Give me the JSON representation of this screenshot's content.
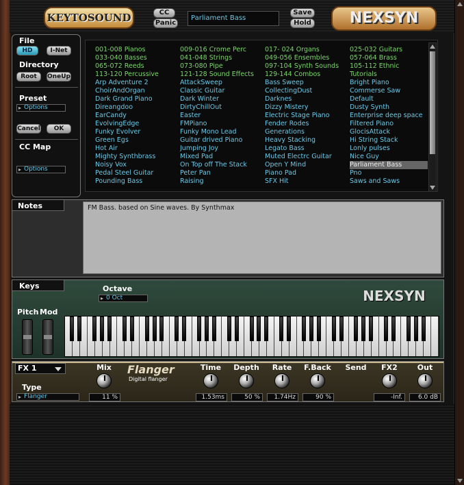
{
  "header": {
    "left_logo": "KEYTOSOUND",
    "right_logo": "NEXSYN",
    "cc_label": "CC",
    "panic_label": "Panic",
    "save_label": "Save",
    "hold_label": "Hold",
    "preset_name": "Parliament Bass"
  },
  "left": {
    "file_title": "File",
    "hd_label": "HD",
    "inet_label": "I-Net",
    "directory_title": "Directory",
    "root_label": "Root",
    "oneup_label": "OneUp",
    "preset_title": "Preset",
    "preset_options": "Options",
    "cancel_label": "Cancel",
    "ok_label": "OK",
    "ccmap_title": "CC Map",
    "ccmap_options": "Options"
  },
  "presets": [
    {
      "text": "001-008 Pianos",
      "cat": true
    },
    {
      "text": "009-016 Crome Perc",
      "cat": true
    },
    {
      "text": "017- 024 Organs",
      "cat": true
    },
    {
      "text": "025-032 Guitars",
      "cat": true
    },
    {
      "text": "033-040 Basses",
      "cat": true
    },
    {
      "text": "041-048 Strings",
      "cat": true
    },
    {
      "text": "049-056 Ensembles",
      "cat": true
    },
    {
      "text": "057-064 Brass",
      "cat": true
    },
    {
      "text": "065-072 Reeds",
      "cat": true
    },
    {
      "text": "073-080 Pipe",
      "cat": true
    },
    {
      "text": "097-104 Synth Sounds",
      "cat": true
    },
    {
      "text": "105-112 Ethnic",
      "cat": true
    },
    {
      "text": "113-120 Percussive",
      "cat": true
    },
    {
      "text": "121-128 Sound Effects",
      "cat": true
    },
    {
      "text": "129-144 Combos",
      "cat": true
    },
    {
      "text": "Tutorials",
      "cat": true
    },
    {
      "text": "Arp Adventure 2"
    },
    {
      "text": "AttackSweep"
    },
    {
      "text": "Bass Sweep"
    },
    {
      "text": "Bright Piano"
    },
    {
      "text": "ChoirAndOrgan"
    },
    {
      "text": "Classic Guitar"
    },
    {
      "text": "CollectingDust"
    },
    {
      "text": "Commerse Saw"
    },
    {
      "text": "Dark Grand Piano"
    },
    {
      "text": "Dark Winter"
    },
    {
      "text": "Darknes"
    },
    {
      "text": "Default"
    },
    {
      "text": "Direangdoo"
    },
    {
      "text": "DirtyChillOut"
    },
    {
      "text": "Dizzy Mistery"
    },
    {
      "text": "Dusty Synth"
    },
    {
      "text": "EarCandy"
    },
    {
      "text": "Easter"
    },
    {
      "text": "Electric Stage Piano"
    },
    {
      "text": "Enterprise deep space"
    },
    {
      "text": "EvolvingEdge"
    },
    {
      "text": "FMPiano"
    },
    {
      "text": "Fender Rodes"
    },
    {
      "text": "Filtered Piano"
    },
    {
      "text": "Funky Evolver"
    },
    {
      "text": "Funky Mono Lead"
    },
    {
      "text": "Generations"
    },
    {
      "text": "GlocisAttack"
    },
    {
      "text": "Green Egs"
    },
    {
      "text": "Guitar drived Piano"
    },
    {
      "text": "Heavy Stacking"
    },
    {
      "text": "Hi String Stack"
    },
    {
      "text": "Hot Air"
    },
    {
      "text": "Jumping Joy"
    },
    {
      "text": "Legato Bass"
    },
    {
      "text": "Lonly pulses"
    },
    {
      "text": "Mighty Synthbrass"
    },
    {
      "text": "Mixed Pad"
    },
    {
      "text": "Muted Electrc Guitar"
    },
    {
      "text": "Nice Guy"
    },
    {
      "text": "Noisy Vox"
    },
    {
      "text": "On Top off The Stack"
    },
    {
      "text": "Open Y Mind"
    },
    {
      "text": "Parliament Bass",
      "selected": true
    },
    {
      "text": "Pedal Steel Guitar"
    },
    {
      "text": "Peter Pan"
    },
    {
      "text": "Piano Pad"
    },
    {
      "text": "Pno"
    },
    {
      "text": "Pounding Bass"
    },
    {
      "text": "Raising"
    },
    {
      "text": "SFX Hit"
    },
    {
      "text": "Saws and Saws"
    }
  ],
  "notes": {
    "label": "Notes",
    "text": "FM Bass. based on Sine waves. By Synthmax"
  },
  "keys": {
    "label": "Keys",
    "octave_label": "Octave",
    "octave_value": "0 Oct",
    "pitch_label": "Pitch",
    "mod_label": "Mod",
    "logo": "NEXSYN"
  },
  "fx": {
    "slot": "FX 1",
    "type_label": "Type",
    "type_value": "Flanger",
    "effect_name": "Flanger",
    "effect_desc": "Digital flanger",
    "mix_label": "Mix",
    "mix_value": "11 %",
    "time_label": "Time",
    "time_value": "1.53ms",
    "depth_label": "Depth",
    "depth_value": "50 %",
    "rate_label": "Rate",
    "rate_value": "1.74Hz",
    "fback_label": "F.Back",
    "fback_value": "90 %",
    "send_label": "Send",
    "fx2_label": "FX2",
    "fx2_value": "-Inf.",
    "out_label": "Out",
    "out_value": "6.0 dB"
  }
}
